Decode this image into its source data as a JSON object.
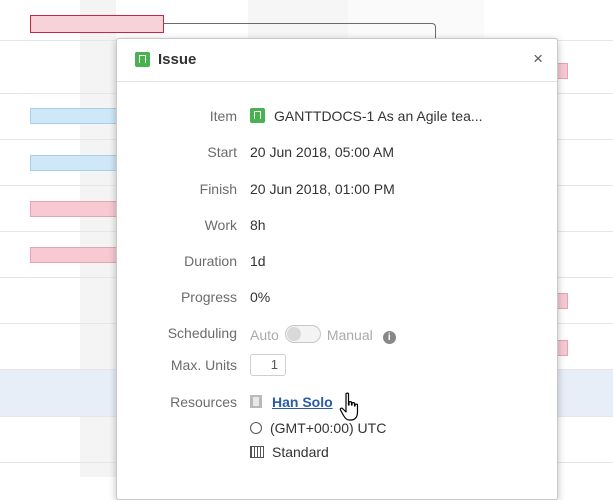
{
  "popup": {
    "title": "Issue",
    "close": "×",
    "fields": {
      "item_label": "Item",
      "item_value": "GANTTDOCS-1 As an Agile tea...",
      "start_label": "Start",
      "start_value": "20 Jun 2018, 05:00 AM",
      "finish_label": "Finish",
      "finish_value": "20 Jun 2018, 01:00 PM",
      "work_label": "Work",
      "work_value": "8h",
      "duration_label": "Duration",
      "duration_value": "1d",
      "progress_label": "Progress",
      "progress_value": "0%",
      "scheduling_label": "Scheduling",
      "scheduling_auto": "Auto",
      "scheduling_manual": "Manual",
      "scheduling_toggle_on": false,
      "max_units_label": "Max. Units",
      "max_units_value": "1",
      "resources_label": "Resources",
      "resource_name": "Han Solo",
      "timezone": "(GMT+00:00) UTC",
      "calendar": "Standard"
    }
  },
  "icons": {
    "item_type": "issue-icon",
    "info": "info-icon",
    "resource": "person-icon",
    "timezone": "clock-icon",
    "calendar": "calendar-icon",
    "cursor": "hand-pointer-cursor"
  },
  "colors": {
    "issue_green": "#47b24f",
    "link_blue": "#2a5aa8",
    "bar_red_fill": "#f7c9d2",
    "bar_red_selected_border": "#c4293f",
    "bar_blue_fill": "#cfe8f8",
    "row_highlight": "#e8eef8"
  }
}
